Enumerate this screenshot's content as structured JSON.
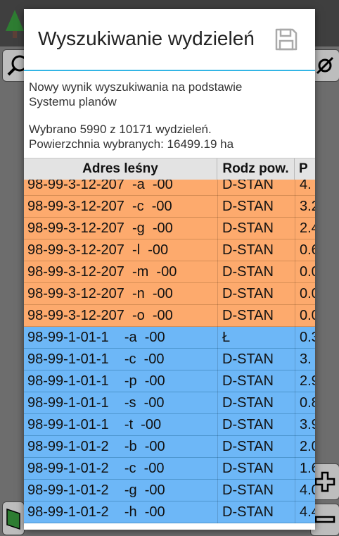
{
  "dialog": {
    "title": "Wyszukiwanie wydzieleń",
    "info_line1": "Nowy wynik wyszukiwania na podstawie",
    "info_line2": "Systemu planów",
    "info_line3": "Wybrano 5990 z 10171 wydzieleń.",
    "info_line4": "Powierzchnia wybranych: 16499.19 ha",
    "save_icon": "floppy-disk-icon"
  },
  "table": {
    "headers": [
      "Adres leśny",
      "Rodz pow.",
      "P"
    ],
    "rows": [
      {
        "addr": "98-99-3-12-207  -a  -00",
        "type": "D-STAN",
        "p": "4.",
        "group": "orange"
      },
      {
        "addr": "98-99-3-12-207  -c  -00",
        "type": "D-STAN",
        "p": "3.2",
        "group": "orange"
      },
      {
        "addr": "98-99-3-12-207  -g  -00",
        "type": "D-STAN",
        "p": "2.4",
        "group": "orange"
      },
      {
        "addr": "98-99-3-12-207  -l  -00",
        "type": "D-STAN",
        "p": "0.6",
        "group": "orange"
      },
      {
        "addr": "98-99-3-12-207  -m  -00",
        "type": "D-STAN",
        "p": "0.0",
        "group": "orange"
      },
      {
        "addr": "98-99-3-12-207  -n  -00",
        "type": "D-STAN",
        "p": "0.0",
        "group": "orange"
      },
      {
        "addr": "98-99-3-12-207  -o  -00",
        "type": "D-STAN",
        "p": "0.0",
        "group": "orange"
      },
      {
        "addr": "98-99-1-01-1    -a  -00",
        "type": "Ł",
        "p": "0.3",
        "group": "blue"
      },
      {
        "addr": "98-99-1-01-1    -c  -00",
        "type": "D-STAN",
        "p": "3.",
        "group": "blue"
      },
      {
        "addr": "98-99-1-01-1    -p  -00",
        "type": "D-STAN",
        "p": "2.9",
        "group": "blue"
      },
      {
        "addr": "98-99-1-01-1    -s  -00",
        "type": "D-STAN",
        "p": "0.8",
        "group": "blue"
      },
      {
        "addr": "98-99-1-01-1    -t  -00",
        "type": "D-STAN",
        "p": "3.9",
        "group": "blue"
      },
      {
        "addr": "98-99-1-01-2    -b  -00",
        "type": "D-STAN",
        "p": "2.0",
        "group": "blue"
      },
      {
        "addr": "98-99-1-01-2    -c  -00",
        "type": "D-STAN",
        "p": "1.6",
        "group": "blue"
      },
      {
        "addr": "98-99-1-01-2    -g  -00",
        "type": "D-STAN",
        "p": "4.0",
        "group": "blue"
      },
      {
        "addr": "98-99-1-01-2    -h  -00",
        "type": "D-STAN",
        "p": "4.4",
        "group": "blue"
      }
    ]
  },
  "colors": {
    "accent": "#33b5e5",
    "orange_row": "#fdaa6d",
    "blue_row": "#6db7f7"
  },
  "background": {
    "icons": [
      "tree-icon",
      "search-icon",
      "location-icon",
      "plus-icon",
      "minus-icon",
      "map-layer-icon"
    ]
  }
}
